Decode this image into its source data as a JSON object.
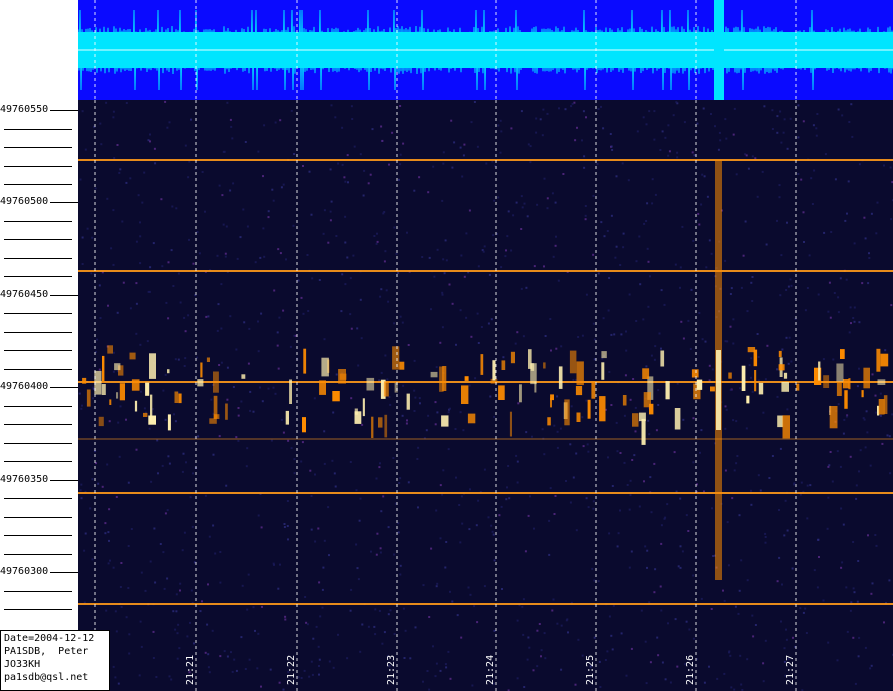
{
  "colors": {
    "background": "#ffffff",
    "waveform_bg": "#0a0aff",
    "waveform_signal": "#00e5ff",
    "spectrogram_bg": "#0a0a2e",
    "carrier_line": "#ff9a1a",
    "burst_hot": "#fff0b0",
    "burst_warm": "#ff8c00",
    "gridline": "#ffffff"
  },
  "frequency_axis": {
    "labels": [
      "49760550",
      "49760500",
      "49760450",
      "49760400",
      "49760350",
      "49760300"
    ]
  },
  "time_axis": {
    "labels": [
      "21:21",
      "21:22",
      "21:23",
      "21:24",
      "21:25",
      "21:26",
      "21:27"
    ]
  },
  "info": {
    "date": "Date=2004-12-12",
    "operator": "PA1SDB,  Peter",
    "locator": "JO33KH",
    "email": "pa1sdb@qsl.net"
  }
}
